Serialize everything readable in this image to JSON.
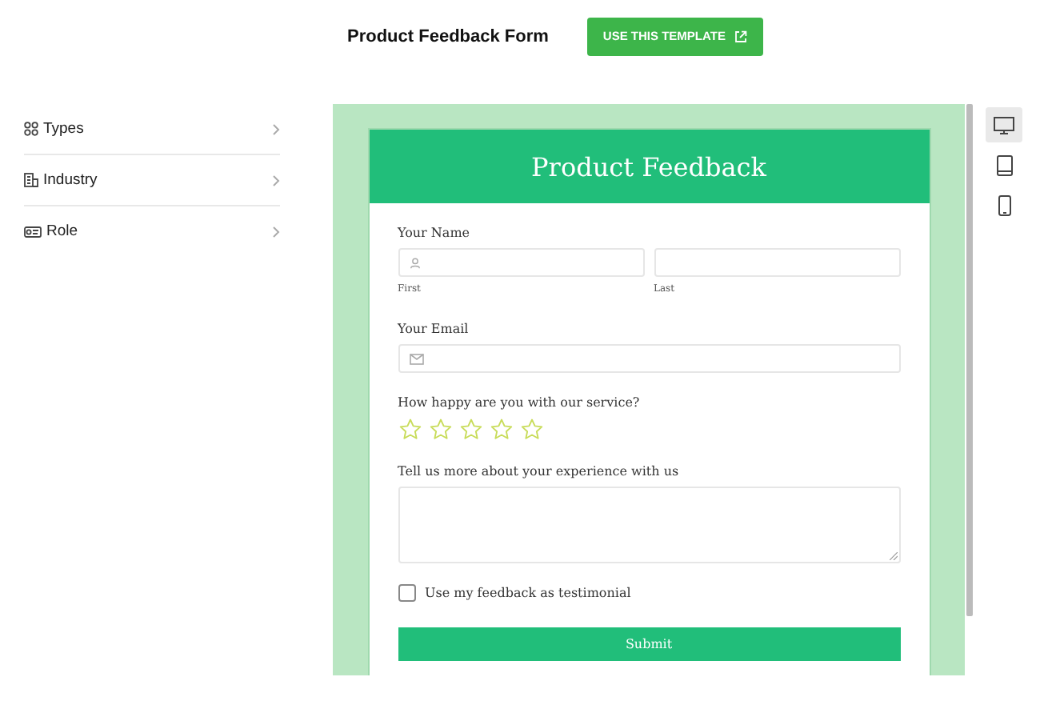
{
  "header": {
    "title": "Product Feedback Form",
    "button": "USE THIS TEMPLATE"
  },
  "sidebar": {
    "items": [
      {
        "label": "Types",
        "kind": "types"
      },
      {
        "label": "Industry",
        "kind": "industry"
      },
      {
        "label": "Role",
        "kind": "role"
      }
    ]
  },
  "form": {
    "title": "Product Feedback",
    "name": {
      "label": "Your Name",
      "first": "First",
      "last": "Last"
    },
    "email": {
      "label": "Your Email"
    },
    "rating": {
      "label": "How happy are you with our service?",
      "stars": 0
    },
    "comments": {
      "label": "Tell us more about your experience with us"
    },
    "testimonial": {
      "label": "Use my feedback as testimonial",
      "checked": false
    },
    "submit": "Submit"
  },
  "devices": [
    {
      "kind": "desktop",
      "selected": true
    },
    {
      "kind": "tablet",
      "selected": false
    },
    {
      "kind": "phone",
      "selected": false
    }
  ]
}
